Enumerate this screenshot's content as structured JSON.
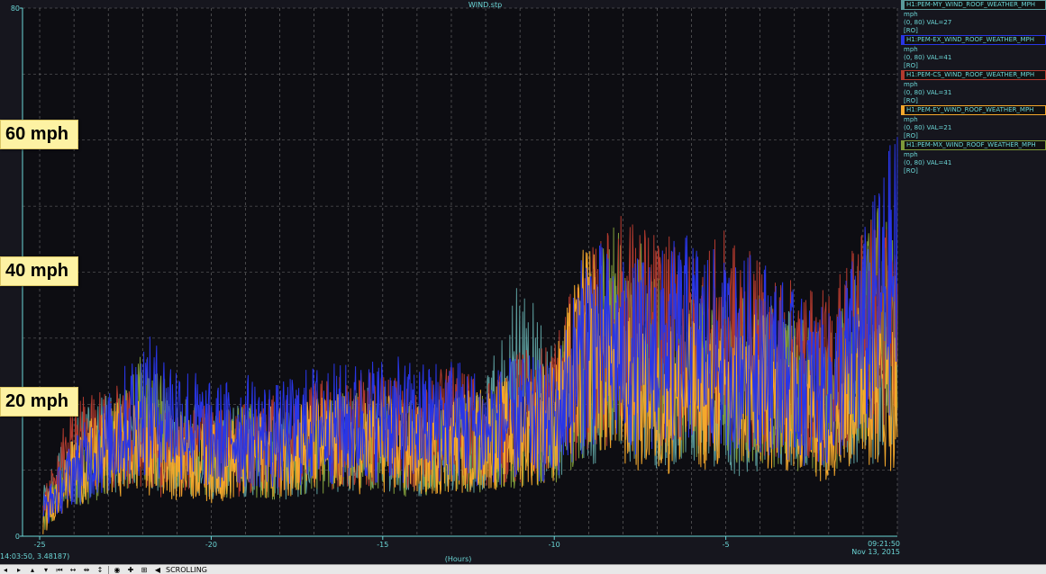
{
  "window": {
    "title": "WIND.stp"
  },
  "chart_data": {
    "type": "line",
    "title": "WIND.stp",
    "xlabel": "(Hours)",
    "ylabel": "",
    "xlim": [
      -25.5,
      0
    ],
    "ylim": [
      0,
      80
    ],
    "x_ticks": [
      "-25",
      "-20",
      "-15",
      "-10",
      "-5"
    ],
    "y_ticks": [
      "80",
      "0"
    ],
    "grid": true,
    "time_stamp": [
      "09:21:50",
      "Nov 13, 2015"
    ],
    "series": [
      {
        "name": "H1:PEM-MY_WIND_ROOF_WEATHER_MPH",
        "color": "#5a9a9a",
        "current": 27,
        "x": [
          -25,
          -24,
          -23,
          -22,
          -21,
          -20,
          -19,
          -18,
          -17,
          -16,
          -15,
          -14,
          -13,
          -12,
          -11,
          -10,
          -9,
          -8,
          -7,
          -6,
          -5,
          -4,
          -3,
          -2,
          -1,
          0
        ],
        "values": [
          4,
          12,
          14,
          15,
          12,
          12,
          13,
          12,
          13,
          14,
          15,
          13,
          14,
          15,
          26,
          18,
          24,
          25,
          22,
          22,
          19,
          22,
          22,
          20,
          22,
          27
        ]
      },
      {
        "name": "H1:PEM-EX_WIND_ROOF_WEATHER_MPH",
        "color": "#2936e6",
        "current": 41,
        "x": [
          -25,
          -24,
          -23,
          -22,
          -21,
          -20,
          -19,
          -18,
          -17,
          -16,
          -15,
          -14,
          -13,
          -12,
          -11,
          -10,
          -9,
          -8,
          -7,
          -6,
          -5,
          -4,
          -3,
          -2,
          -1,
          0
        ],
        "values": [
          3,
          10,
          14,
          20,
          18,
          15,
          16,
          15,
          17,
          17,
          18,
          17,
          18,
          16,
          18,
          17,
          30,
          27,
          28,
          30,
          27,
          28,
          24,
          22,
          30,
          41
        ]
      },
      {
        "name": "H1:PEM-CS_WIND_ROOF_WEATHER_MPH",
        "color": "#b23a2e",
        "current": 31,
        "x": [
          -25,
          -24,
          -23,
          -22,
          -21,
          -20,
          -19,
          -18,
          -17,
          -16,
          -15,
          -14,
          -13,
          -12,
          -11,
          -10,
          -9,
          -8,
          -7,
          -6,
          -5,
          -4,
          -3,
          -2,
          -1,
          0
        ],
        "values": [
          3,
          14,
          15,
          14,
          12,
          13,
          13,
          14,
          15,
          16,
          16,
          15,
          17,
          16,
          18,
          20,
          28,
          32,
          30,
          28,
          30,
          27,
          25,
          24,
          32,
          31
        ]
      },
      {
        "name": "H1:PEM-EY_WIND_ROOF_WEATHER_MPH",
        "color": "#f4a82c",
        "current": 21,
        "x": [
          -25,
          -24,
          -23,
          -22,
          -21,
          -20,
          -19,
          -18,
          -17,
          -16,
          -15,
          -14,
          -13,
          -12,
          -11,
          -10,
          -9,
          -8,
          -7,
          -6,
          -5,
          -4,
          -3,
          -2,
          -1,
          0
        ],
        "values": [
          2,
          10,
          13,
          14,
          12,
          11,
          12,
          13,
          14,
          14,
          14,
          13,
          14,
          15,
          16,
          18,
          30,
          22,
          20,
          22,
          21,
          22,
          20,
          18,
          24,
          21
        ]
      },
      {
        "name": "H1:PEM-MX_WIND_ROOF_WEATHER_MPH",
        "color": "#7e9a3a",
        "current": 41,
        "x": [
          -25,
          -24,
          -23,
          -22,
          -21,
          -20,
          -19,
          -18,
          -17,
          -16,
          -15,
          -14,
          -13,
          -12,
          -11,
          -10,
          -9,
          -8,
          -7,
          -6,
          -5,
          -4,
          -3,
          -2,
          -1,
          0
        ],
        "values": [
          3,
          9,
          12,
          18,
          14,
          12,
          13,
          12,
          14,
          14,
          14,
          13,
          14,
          14,
          16,
          17,
          26,
          32,
          26,
          25,
          24,
          24,
          22,
          20,
          28,
          41
        ]
      }
    ]
  },
  "legend": [
    {
      "name": "H1:PEM-MY_WIND_ROOF_WEATHER_MPH",
      "unit": "mph",
      "range": "(0, 80) VAL=27",
      "mode": "[RO]",
      "color": "#5a9a9a"
    },
    {
      "name": "H1:PEM-EX_WIND_ROOF_WEATHER_MPH",
      "unit": "mph",
      "range": "(0, 80) VAL=41",
      "mode": "[RO]",
      "color": "#2936e6"
    },
    {
      "name": "H1:PEM-CS_WIND_ROOF_WEATHER_MPH",
      "unit": "mph",
      "range": "(0, 80) VAL=31",
      "mode": "[RO]",
      "color": "#b23a2e"
    },
    {
      "name": "H1:PEM-EY_WIND_ROOF_WEATHER_MPH",
      "unit": "mph",
      "range": "(0, 80) VAL=21",
      "mode": "[RO]",
      "color": "#f4a82c"
    },
    {
      "name": "H1:PEM-MX_WIND_ROOF_WEATHER_MPH",
      "unit": "mph",
      "range": "(0, 80) VAL=41",
      "mode": "[RO]",
      "color": "#7e9a3a"
    }
  ],
  "annotations": {
    "mph_60": "60 mph",
    "mph_40": "40 mph",
    "mph_20": "20 mph"
  },
  "status": {
    "cursor": "14:03:50, 3.48187)",
    "mode": "SCROLLING"
  },
  "toolbar": {
    "icons": [
      "step-left-icon",
      "arrow-right-icon",
      "arrow-up-icon",
      "arrow-down-icon",
      "skip-left-icon",
      "expand-h-icon",
      "contract-h-icon",
      "expand-v-icon",
      "record-icon",
      "plus-icon",
      "zoom-icon",
      "back-icon"
    ]
  }
}
